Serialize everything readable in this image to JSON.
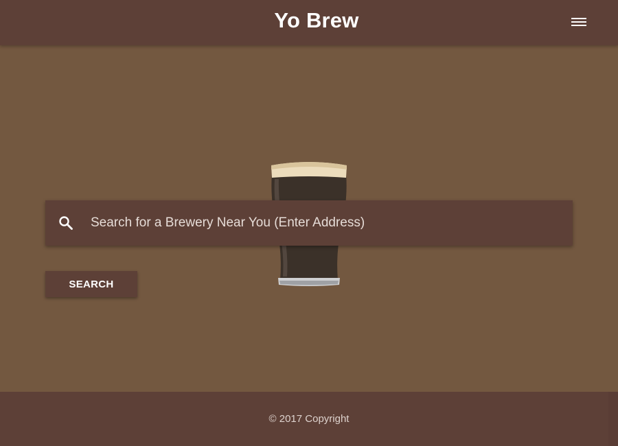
{
  "navbar": {
    "brand": "Yo Brew",
    "menu_icon": "hamburger-menu-icon"
  },
  "hero": {
    "image": "beer-pint-icon"
  },
  "search": {
    "icon": "search-icon",
    "placeholder": "Search for a Brewery Near You (Enter Address)",
    "value": "",
    "button_label": "SEARCH"
  },
  "footer": {
    "copyright": "© 2017 Copyright"
  },
  "colors": {
    "page_background": "#735840",
    "bar_background": "#5d4037",
    "text_light": "#ffffff"
  }
}
